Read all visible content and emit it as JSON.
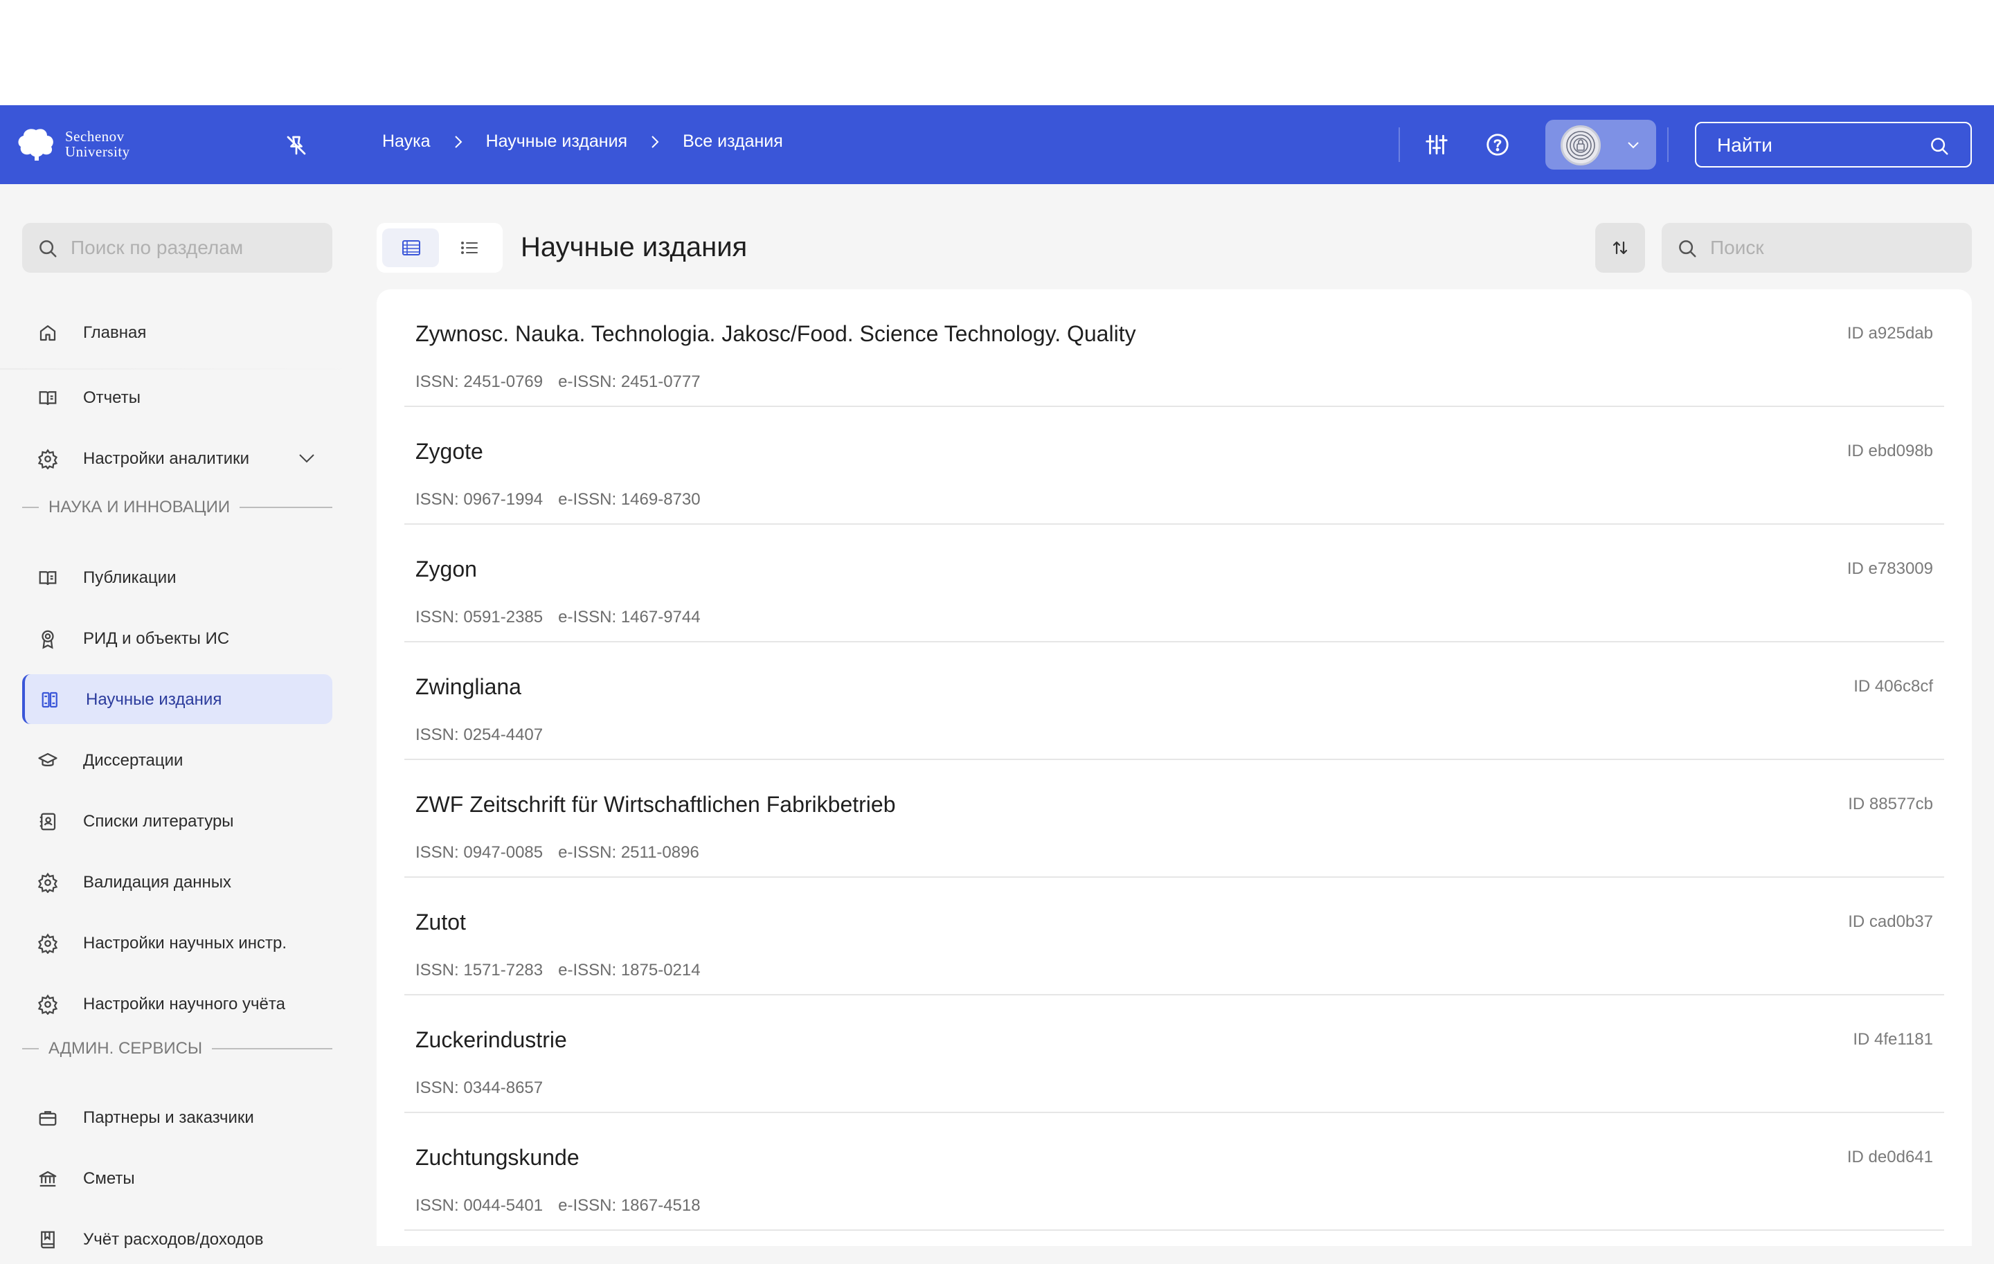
{
  "header": {
    "logo_line1": "Sechenov",
    "logo_line2": "University",
    "breadcrumbs": [
      "Наука",
      "Научные издания",
      "Все издания"
    ],
    "search_placeholder": "Найти"
  },
  "sidebar": {
    "search_placeholder": "Поиск по разделам",
    "top_items": [
      {
        "label": "Главная",
        "icon": "home-icon"
      },
      {
        "label": "Отчеты",
        "icon": "book-icon"
      },
      {
        "label": "Настройки аналитики",
        "icon": "gear-icon"
      }
    ],
    "section1": "НАУКА И ИННОВАЦИИ",
    "science_items": [
      {
        "label": "Публикации",
        "icon": "book-icon"
      },
      {
        "label": "РИД и объекты ИС",
        "icon": "award-icon"
      },
      {
        "label": "Научные издания",
        "icon": "journals-icon",
        "active": true
      },
      {
        "label": "Диссертации",
        "icon": "graduation-cap-icon"
      },
      {
        "label": "Списки литературы",
        "icon": "contacts-book-icon"
      },
      {
        "label": "Валидация данных",
        "icon": "gear-icon"
      },
      {
        "label": "Настройки научных инстр.",
        "icon": "gear-icon"
      },
      {
        "label": "Настройки научного учёта",
        "icon": "gear-icon"
      }
    ],
    "section2": "АДМИН. СЕРВИСЫ",
    "admin_items": [
      {
        "label": "Партнеры и заказчики",
        "icon": "briefcase-icon"
      },
      {
        "label": "Сметы",
        "icon": "bank-icon"
      },
      {
        "label": "Учёт расходов/доходов",
        "icon": "ledger-icon"
      }
    ]
  },
  "main": {
    "title": "Научные издания",
    "search_placeholder": "Поиск",
    "rows": [
      {
        "title": "Zywnosc. Nauka. Technologia. Jakosc/Food. Science Technology. Quality",
        "id": "ID a925dab",
        "issn": "ISSN: 2451-0769",
        "eissn": "e-ISSN: 2451-0777"
      },
      {
        "title": "Zygote",
        "id": "ID ebd098b",
        "issn": "ISSN: 0967-1994",
        "eissn": "e-ISSN: 1469-8730"
      },
      {
        "title": "Zygon",
        "id": "ID e783009",
        "issn": "ISSN: 0591-2385",
        "eissn": "e-ISSN: 1467-9744"
      },
      {
        "title": "Zwingliana",
        "id": "ID 406c8cf",
        "issn": "ISSN: 0254-4407",
        "eissn": ""
      },
      {
        "title": "ZWF Zeitschrift für Wirtschaftlichen Fabrikbetrieb",
        "id": "ID 88577cb",
        "issn": "ISSN: 0947-0085",
        "eissn": "e-ISSN: 2511-0896"
      },
      {
        "title": "Zutot",
        "id": "ID cad0b37",
        "issn": "ISSN: 1571-7283",
        "eissn": "e-ISSN: 1875-0214"
      },
      {
        "title": "Zuckerindustrie",
        "id": "ID 4fe1181",
        "issn": "ISSN: 0344-8657",
        "eissn": ""
      },
      {
        "title": "Zuchtungskunde",
        "id": "ID de0d641",
        "issn": "ISSN: 0044-5401",
        "eissn": "e-ISSN: 1867-4518"
      }
    ]
  },
  "colors": {
    "accent": "#3a56d8",
    "active_bg": "#e1e6fb"
  }
}
